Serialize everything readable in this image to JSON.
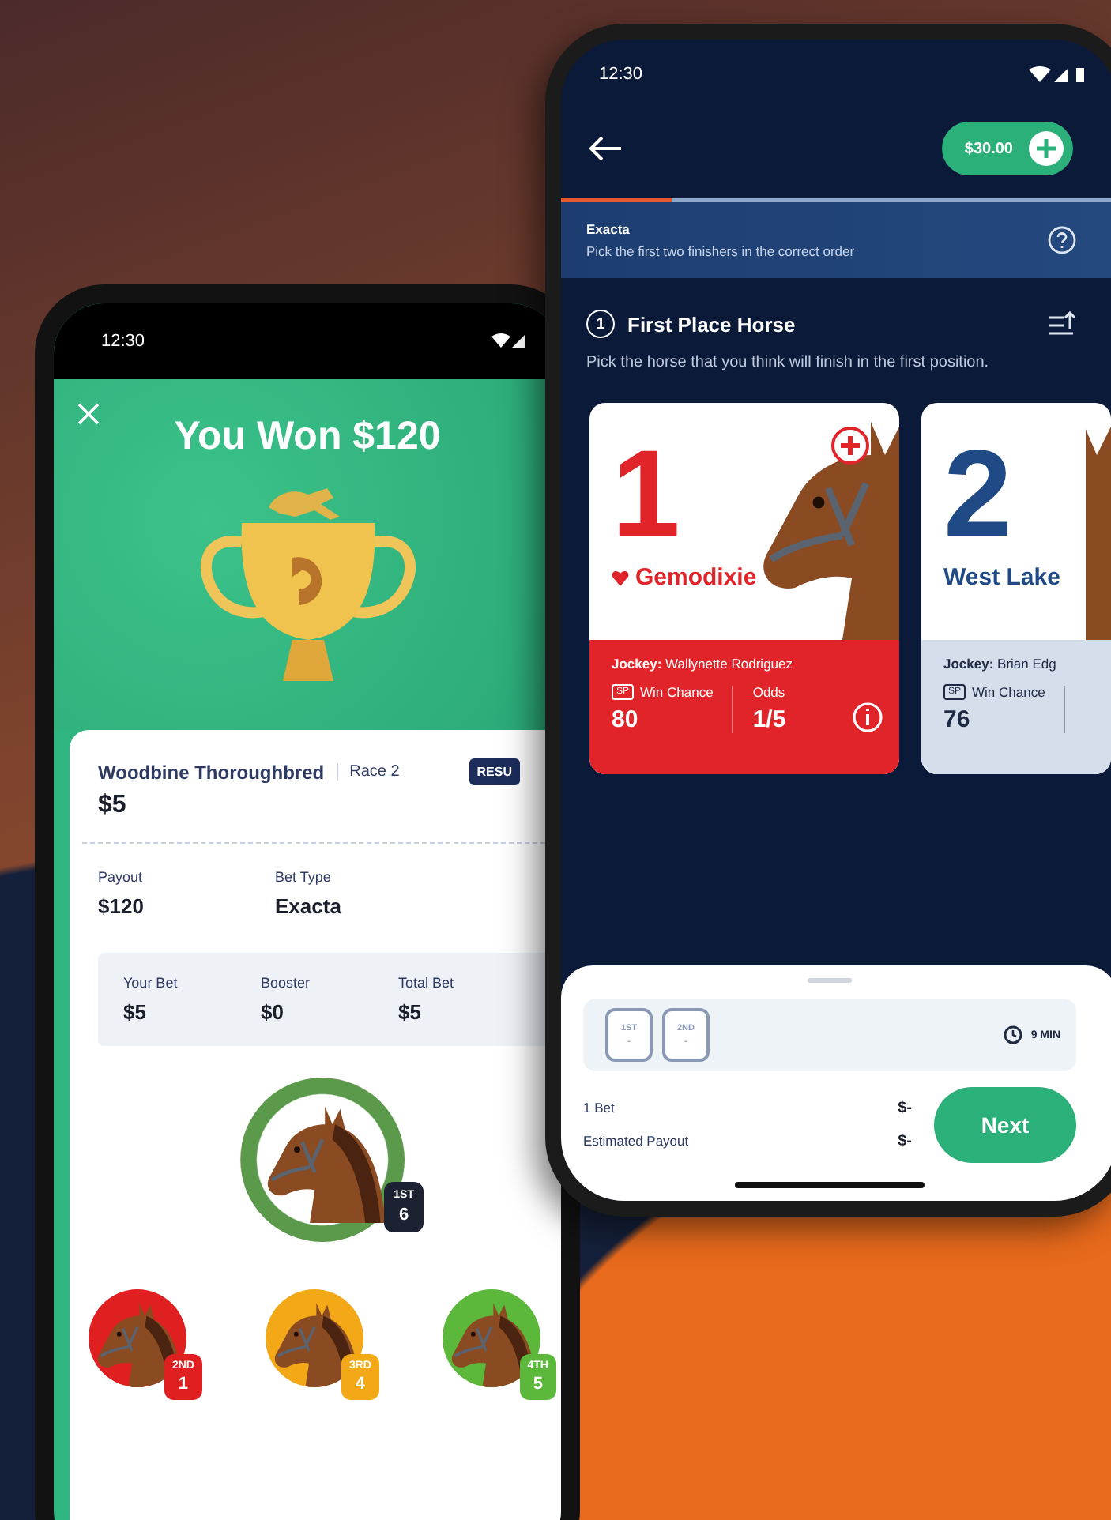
{
  "result_phone": {
    "status_bar": {
      "time": "12:30"
    },
    "header": {
      "title": "You Won $120"
    },
    "ticket": {
      "track": "Woodbine Thoroughbred",
      "race": "Race 2",
      "badge": "RESU",
      "stake": "$5",
      "details": [
        {
          "label": "Payout",
          "value": "$120"
        },
        {
          "label": "Bet Type",
          "value": "Exacta"
        }
      ],
      "summary": [
        {
          "label": "Your Bet",
          "value": "$5"
        },
        {
          "label": "Booster",
          "value": "$0"
        },
        {
          "label": "Total Bet",
          "value": "$5"
        }
      ]
    },
    "winner": {
      "place": "1ST",
      "number": "6"
    },
    "finishers": [
      {
        "place": "2ND",
        "number": "1",
        "color": "#e02020"
      },
      {
        "place": "3RD",
        "number": "4",
        "color": "#f2a817"
      },
      {
        "place": "4TH",
        "number": "5",
        "color": "#5cb83a"
      }
    ]
  },
  "betting_phone": {
    "status_bar": {
      "time": "12:30"
    },
    "balance": "$30.00",
    "progress": {
      "level": 0.2
    },
    "bet_info": {
      "title": "Exacta",
      "subtitle": "Pick the first two finishers in the correct order"
    },
    "step": {
      "number": "1",
      "title": "First Place Horse",
      "description": "Pick the horse that you think will finish in the first position."
    },
    "horses": [
      {
        "number": "1",
        "name": "Gemodixie",
        "favorite": true,
        "jockey": "**Jockey:** Wallynette Rodriguez",
        "sp": "SP",
        "win_chance_label": "Win Chance",
        "win_chance": "80",
        "odds_label": "Odds",
        "odds": "1/5",
        "selected": true
      },
      {
        "number": "2",
        "name": "West Lake",
        "favorite": false,
        "jockey": "**Jockey:** Brian Edg",
        "sp": "SP",
        "win_chance_label": "Win Chance",
        "win_chance": "76",
        "selected": false
      }
    ],
    "slip": {
      "slots": [
        {
          "label": "1ST",
          "value": "-"
        },
        {
          "label": "2ND",
          "value": "-"
        }
      ],
      "time_left": "9 MIN",
      "rows": [
        {
          "label": "1 Bet",
          "value": "$-"
        },
        {
          "label": "Estimated Payout",
          "value": "$-"
        }
      ],
      "button": "Next"
    }
  }
}
